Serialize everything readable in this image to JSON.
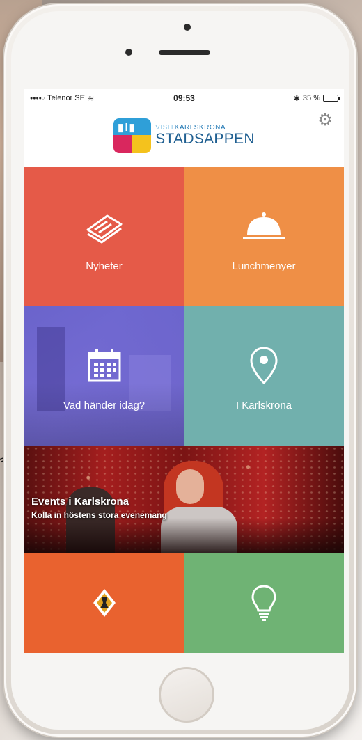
{
  "status_bar": {
    "carrier": "Telenor SE",
    "time": "09:53",
    "battery_percent": "35 %",
    "battery_level": 0.35
  },
  "header": {
    "logo_small_visit": "VISIT",
    "logo_small_city": "KARLSKRONA",
    "logo_big": "STADSAPPEN",
    "settings_icon": "gear-icon"
  },
  "tiles": {
    "nyheter": {
      "label": "Nyheter",
      "icon": "newspaper-icon",
      "color": "#e55a48"
    },
    "lunch": {
      "label": "Lunchmenyer",
      "icon": "cloche-icon",
      "color": "#ef8f46"
    },
    "vad": {
      "label": "Vad händer idag?",
      "icon": "calendar-icon",
      "color": "#6c64d2"
    },
    "karlskrona": {
      "label": "I Karlskrona",
      "icon": "location-pin-icon",
      "color": "#71b0ad"
    },
    "bottom_left": {
      "icon": "coat-of-arms-icon",
      "color": "#e9622f"
    },
    "bottom_right": {
      "icon": "lightbulb-icon",
      "color": "#6fb374"
    }
  },
  "banner": {
    "title": "Events i Karlskrona",
    "subtitle": "Kolla in höstens stora evenemang"
  }
}
